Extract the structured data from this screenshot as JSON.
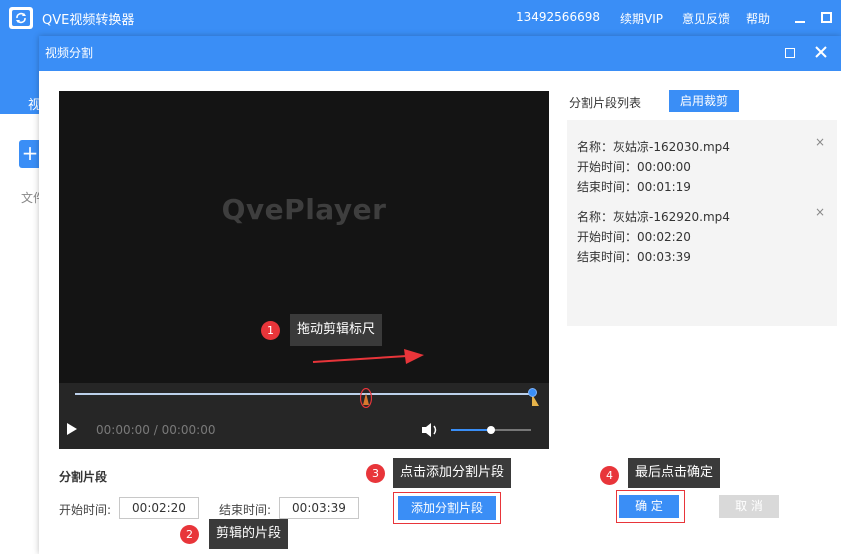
{
  "app": {
    "title": "QVE视频转换器",
    "phone": "13492566698",
    "menu": [
      "续期VIP",
      "意见反馈",
      "帮助"
    ],
    "tab_stub": "视",
    "add_stub": "+",
    "file_stub": "文件"
  },
  "dialog": {
    "title": "视频分割"
  },
  "player": {
    "logo": "QvePlayer",
    "time": "00:00:00 / 00:00:00",
    "volume_level": 0.5
  },
  "annotations": [
    {
      "num": "1",
      "text": "拖动剪辑标尺"
    },
    {
      "num": "2",
      "text": "剪辑的片段"
    },
    {
      "num": "3",
      "text": "点击添加分割片段"
    },
    {
      "num": "4",
      "text": "最后点击确定"
    }
  ],
  "segment": {
    "title": "分割片段",
    "start_label": "开始时间:",
    "start_value": "00:02:20",
    "end_label": "结束时间:",
    "end_value": "00:03:39",
    "add_button": "添加分割片段",
    "ok_button": "确 定",
    "cancel_button": "取 消"
  },
  "list": {
    "title": "分割片段列表",
    "enable_button": "启用裁剪",
    "close_glyph": "×",
    "items": [
      {
        "name": "名称：灰姑凉-162030.mp4",
        "start": "开始时间：00:00:00",
        "end": "结束时间：00:01:19"
      },
      {
        "name": "名称：灰姑凉-162920.mp4",
        "start": "开始时间：00:02:20",
        "end": "结束时间：00:03:39"
      }
    ]
  },
  "colors": {
    "accent": "#3a8ef6",
    "annotation_red": "#e8353a",
    "tip_bg": "#3a3a3a",
    "player_bg": "#141414"
  }
}
